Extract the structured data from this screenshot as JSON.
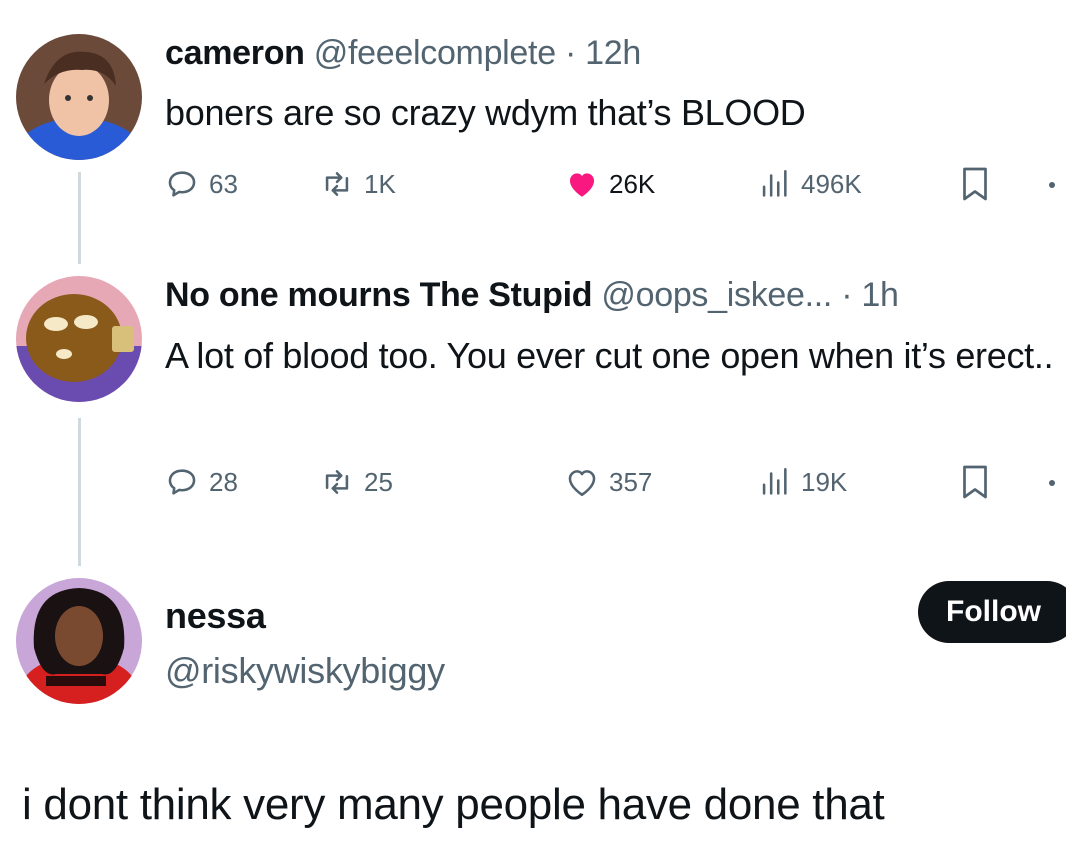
{
  "tweets": [
    {
      "name": "cameron",
      "handle": "@feeelcomplete",
      "time": "· 12h",
      "text": "boners are so crazy wdym that’s BLOOD",
      "replies": "63",
      "reposts": "1K",
      "likes": "26K",
      "views": "496K",
      "liked": true
    },
    {
      "name": "No one mourns The Stupid",
      "handle": "@oops_iskee...",
      "time": "· 1h",
      "text": "A lot of blood too. You ever cut one open when it’s erect..",
      "replies": "28",
      "reposts": "25",
      "likes": "357",
      "views": "19K",
      "liked": false
    }
  ],
  "profile": {
    "name": "nessa",
    "handle": "@riskywiskybiggy",
    "follow_label": "Follow"
  },
  "quote": {
    "text": "i dont think very many people have done that"
  },
  "icons": {
    "reply": "reply-icon",
    "repost": "repost-icon",
    "like": "heart-icon",
    "views": "views-icon",
    "bookmark": "bookmark-icon"
  },
  "colors": {
    "like_active": "#f91880",
    "muted": "#536471",
    "text": "#0f1419",
    "thread_line": "#cfd9de"
  }
}
